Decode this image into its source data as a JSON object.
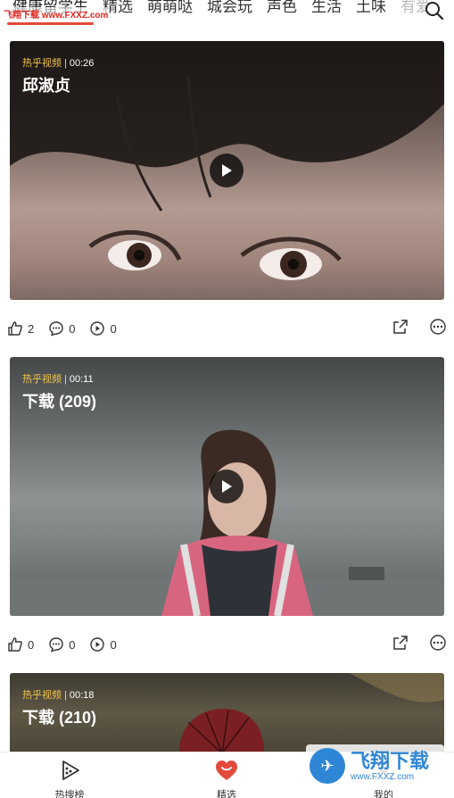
{
  "top_tabs": [
    {
      "label": "健康留学生"
    },
    {
      "label": "精选"
    },
    {
      "label": "萌萌哒"
    },
    {
      "label": "城会玩"
    },
    {
      "label": "声色"
    },
    {
      "label": "生活"
    },
    {
      "label": "土味"
    },
    {
      "label": "有爱"
    }
  ],
  "watermark_top": "飞翔下载 www.FXXZ.com",
  "feed": [
    {
      "source": "热乎视频",
      "duration": "00:26",
      "title": "邱淑贞",
      "likes": "2",
      "comments": "0",
      "plays": "0"
    },
    {
      "source": "热乎视频",
      "duration": "00:11",
      "title": "下载 (209)",
      "likes": "0",
      "comments": "0",
      "plays": "0"
    },
    {
      "source": "热乎视频",
      "duration": "00:18",
      "title": "下载 (210)"
    }
  ],
  "bottom_nav": {
    "items": [
      {
        "label": "热搜榜",
        "icon": "play-list-icon"
      },
      {
        "label": "精选",
        "icon": "heart-icon"
      },
      {
        "label": "我的",
        "icon": "user-icon"
      }
    ]
  },
  "watermark_bottom": {
    "big": "飞翔下载",
    "small": "www.FXXZ.com"
  },
  "colors": {
    "accent": "#e24a3b",
    "source_tag": "#f3c44a"
  }
}
